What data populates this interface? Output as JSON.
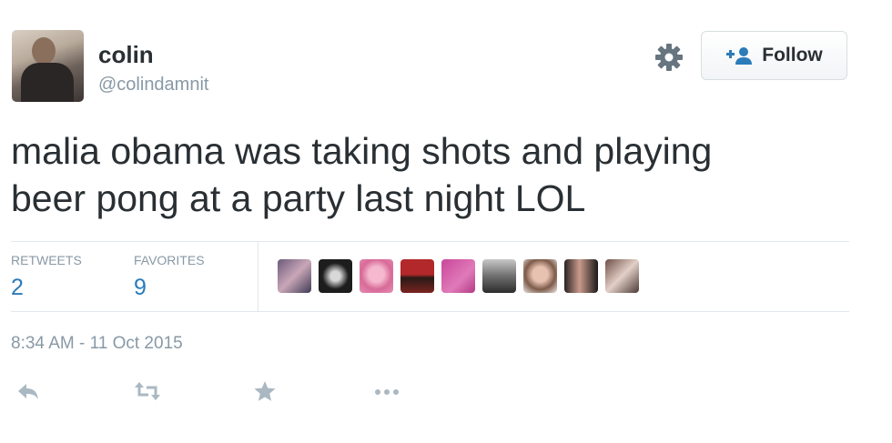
{
  "user": {
    "name": "colin",
    "handle": "@colindamnit"
  },
  "header": {
    "settings_icon": "gear-icon",
    "follow_label": "Follow",
    "follow_icon": "add-user-icon"
  },
  "tweet": {
    "line1": "malia obama was taking shots and playing",
    "line2": "beer pong at a party last night LOL"
  },
  "stats": {
    "retweets_label": "RETWEETS",
    "retweets_count": "2",
    "favorites_label": "FAVORITES",
    "favorites_count": "9"
  },
  "favoriters": [
    "avatar-1",
    "avatar-2",
    "avatar-3",
    "avatar-4",
    "avatar-5",
    "avatar-6",
    "avatar-7",
    "avatar-8",
    "avatar-9"
  ],
  "timestamp": "8:34 AM - 11 Oct 2015",
  "actions": {
    "reply_icon": "reply-icon",
    "retweet_icon": "retweet-icon",
    "favorite_icon": "star-icon",
    "more_icon": "more-icon"
  },
  "colors": {
    "accent": "#2b7bb9",
    "muted": "#8899a6",
    "text": "#292f33"
  }
}
